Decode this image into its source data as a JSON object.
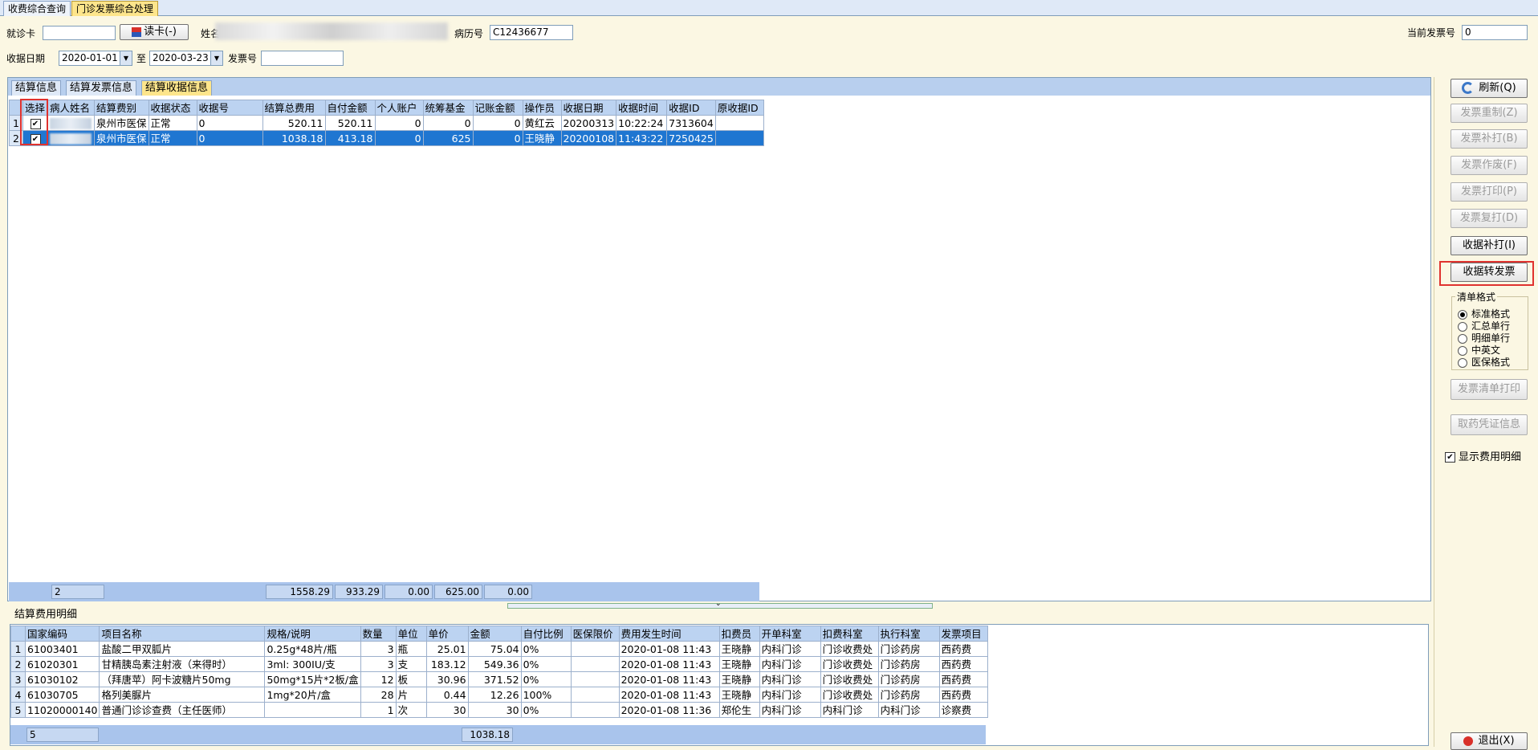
{
  "top_tabs": [
    "收费综合查询",
    "门诊发票综合处理"
  ],
  "form": {
    "card_label": "就诊卡",
    "card_value": "",
    "read_card_label": "读卡(-)",
    "name_label": "姓名",
    "record_label": "病历号",
    "record_value": "C12436677",
    "current_invoice_label": "当前发票号",
    "current_invoice_value": "0",
    "date_label": "收据日期",
    "date_from": "2020-01-01",
    "to_label": "至",
    "date_to": "2020-03-23",
    "invoice_label": "发票号",
    "invoice_value": ""
  },
  "upper_tabs": [
    "结算信息",
    "结算发票信息",
    "结算收据信息"
  ],
  "receipt_table": {
    "columns": [
      "选择",
      "病人姓名",
      "结算费别",
      "收据状态",
      "收据号",
      "结算总费用",
      "自付金额",
      "个人账户",
      "统筹基金",
      "记账金额",
      "操作员",
      "收据日期",
      "收据时间",
      "收据ID",
      "原收据ID"
    ],
    "rows": [
      [
        "1",
        "",
        "泉州市医保",
        "正常",
        "0",
        "520.11",
        "520.11",
        "0",
        "0",
        "0",
        "黄红云",
        "20200313",
        "10:22:24",
        "7313604",
        ""
      ],
      [
        "2",
        "",
        "泉州市医保",
        "正常",
        "0",
        "1038.18",
        "413.18",
        "0",
        "625",
        "0",
        "王晓静",
        "20200108",
        "11:43:22",
        "7250425",
        ""
      ]
    ],
    "summary": {
      "count": "2",
      "total": "1558.29",
      "self_pay": "933.29",
      "personal": "0.00",
      "fund": "625.00",
      "accounting": "0.00"
    }
  },
  "detail": {
    "title": "结算费用明细",
    "columns": [
      "国家编码",
      "项目名称",
      "规格/说明",
      "数量",
      "单位",
      "单价",
      "金额",
      "自付比例",
      "医保限价",
      "费用发生时间",
      "扣费员",
      "开单科室",
      "扣费科室",
      "执行科室",
      "发票项目"
    ],
    "rows": [
      [
        "1",
        "61003401",
        "盐酸二甲双胍片",
        "0.25g*48片/瓶",
        "3",
        "瓶",
        "25.01",
        "75.04",
        "0%",
        "",
        "2020-01-08 11:43",
        "王晓静",
        "内科门诊",
        "门诊收费处",
        "门诊药房",
        "西药费"
      ],
      [
        "2",
        "61020301",
        "甘精胰岛素注射液（来得时）",
        "3ml: 300IU/支",
        "3",
        "支",
        "183.12",
        "549.36",
        "0%",
        "",
        "2020-01-08 11:43",
        "王晓静",
        "内科门诊",
        "门诊收费处",
        "门诊药房",
        "西药费"
      ],
      [
        "3",
        "61030102",
        "（拜唐苹）阿卡波糖片50mg",
        "50mg*15片*2板/盒",
        "12",
        "板",
        "30.96",
        "371.52",
        "0%",
        "",
        "2020-01-08 11:43",
        "王晓静",
        "内科门诊",
        "门诊收费处",
        "门诊药房",
        "西药费"
      ],
      [
        "4",
        "61030705",
        "格列美脲片",
        "1mg*20片/盒",
        "28",
        "片",
        "0.44",
        "12.26",
        "100%",
        "",
        "2020-01-08 11:43",
        "王晓静",
        "内科门诊",
        "门诊收费处",
        "门诊药房",
        "西药费"
      ],
      [
        "5",
        "11020000140",
        "普通门诊诊查费（主任医师）",
        "",
        "1",
        "次",
        "30",
        "30",
        "0%",
        "",
        "2020-01-08 11:36",
        "郑伦生",
        "内科门诊",
        "内科门诊",
        "内科门诊",
        "诊察费"
      ]
    ],
    "summary": {
      "count": "5",
      "amount": "1038.18"
    }
  },
  "buttons": {
    "refresh": "刷新(Q)",
    "reprint_make": "发票重制(Z)",
    "invoice_supplement": "发票补打(B)",
    "invoice_void": "发票作废(F)",
    "invoice_print": "发票打印(P)",
    "invoice_reprint": "发票复打(D)",
    "receipt_supplement": "收据补打(I)",
    "receipt_to_invoice": "收据转发票",
    "list_print": "发票清单打印",
    "voucher_info": "取药凭证信息",
    "exit": "退出(X)"
  },
  "list_format": {
    "title": "清单格式",
    "options": [
      "标准格式",
      "汇总单行",
      "明细单行",
      "中英文",
      "医保格式"
    ],
    "selected": "标准格式"
  },
  "show_detail_label": "显示费用明细",
  "colors": {
    "selection": "#1f76d1",
    "header": "#bcd3f1",
    "highlight_box": "#e0322f",
    "active_tab": "#fde58b"
  }
}
